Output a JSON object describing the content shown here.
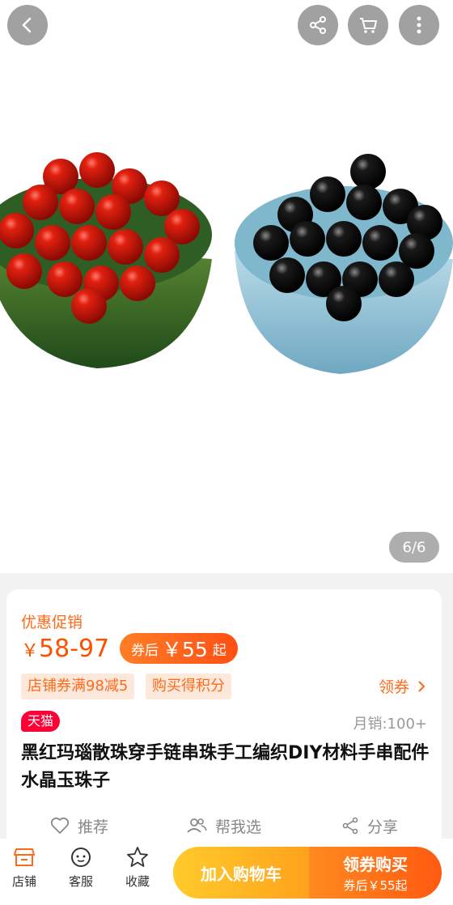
{
  "gallery": {
    "counter": "6/6"
  },
  "promo": {
    "label": "优惠促销",
    "price_yen": "￥",
    "price_range": "58-97",
    "coupon_prefix": "券后",
    "coupon_price": "￥55",
    "coupon_suffix": "起",
    "tags": [
      "店铺券满98减5",
      "购买得积分"
    ],
    "get_coupon": "领券"
  },
  "product": {
    "badge": "天猫",
    "sales": "月销:100+",
    "title": "黑红玛瑙散珠穿手链串珠手工编织DIY材料手串配件水晶玉珠子"
  },
  "actions": {
    "recommend": "推荐",
    "help_choose": "帮我选",
    "share": "分享"
  },
  "bottom": {
    "store": "店铺",
    "service": "客服",
    "favorite": "收藏",
    "add_cart": "加入购物车",
    "buy_main": "领券购买",
    "buy_sub": "券后￥55起"
  },
  "colors": {
    "accent": "#ff5000",
    "tmall": "#ff0036"
  }
}
